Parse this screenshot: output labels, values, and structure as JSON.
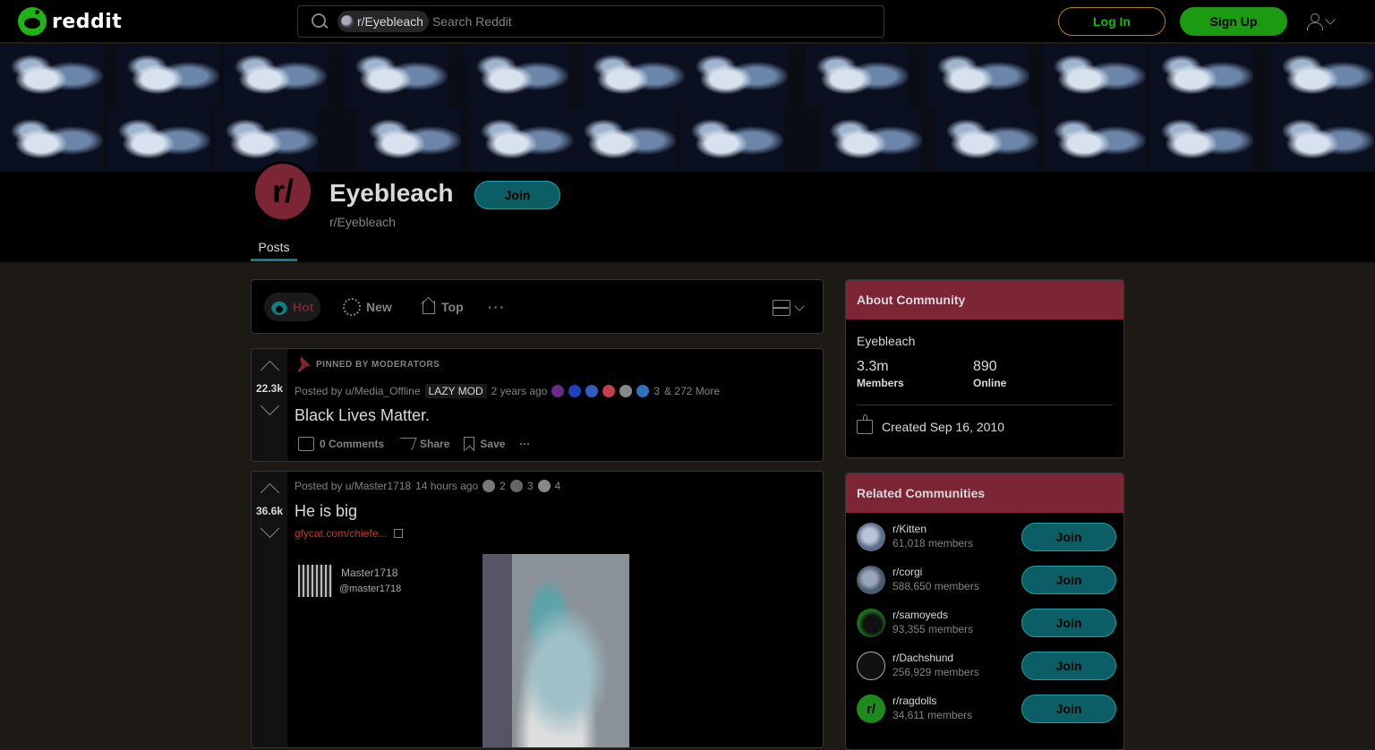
{
  "header": {
    "logo_text": "reddit",
    "search_chip": "r/Eyebleach",
    "search_placeholder": "Search Reddit",
    "login_label": "Log In",
    "signup_label": "Sign Up"
  },
  "community": {
    "avatar_text": "r/",
    "title": "Eyebleach",
    "subreddit": "r/Eyebleach",
    "join_label": "Join",
    "tab_posts": "Posts"
  },
  "sort": {
    "hot": "Hot",
    "new": "New",
    "top": "Top",
    "more": "···"
  },
  "posts": [
    {
      "pinned_label": "PINNED BY MODERATORS",
      "votes": "22.3k",
      "posted_by": "Posted by u/Media_Offline",
      "flair": "LAZY MOD",
      "time": "2 years ago",
      "awards_count": "3",
      "awards_more": "& 272 More",
      "title": "Black Lives Matter.",
      "comments": "0 Comments",
      "share": "Share",
      "save": "Save",
      "more": "···"
    },
    {
      "votes": "36.6k",
      "posted_by": "Posted by u/Master1718",
      "time": "14 hours ago",
      "award1_count": "2",
      "award2_count": "3",
      "award3_count": "4",
      "title": "He is big",
      "link": "gfycat.com/chiefe...",
      "media_name": "Master1718",
      "media_handle": "@master1718"
    }
  ],
  "about": {
    "heading": "About Community",
    "name": "Eyebleach",
    "members_value": "3.3m",
    "members_label": "Members",
    "online_value": "890",
    "online_label": "Online",
    "created": "Created Sep 16, 2010"
  },
  "related": {
    "heading": "Related Communities",
    "join_label": "Join",
    "items": [
      {
        "name": "r/Kitten",
        "members": "61,018 members",
        "color": "#5b6f8a"
      },
      {
        "name": "r/corgi",
        "members": "588,650 members",
        "color": "#4a5a6e"
      },
      {
        "name": "r/samoyeds",
        "members": "93,355 members",
        "color": "#1a6b1a"
      },
      {
        "name": "r/Dachshund",
        "members": "256,929 members",
        "color": "#111111"
      },
      {
        "name": "r/ragdolls",
        "members": "34,611 members",
        "color": "#1c8a1c"
      }
    ]
  }
}
